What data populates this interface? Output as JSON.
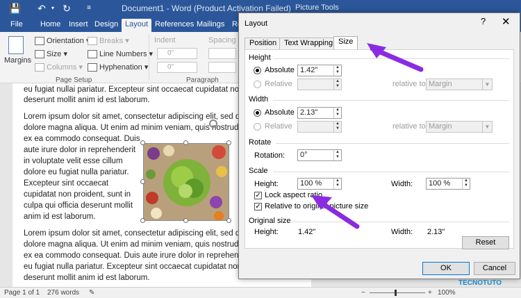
{
  "app": {
    "title": "Document1 - Word (Product Activation Failed)",
    "context_tab": "Picture Tools",
    "file_tab": "File",
    "tabs": [
      "Home",
      "Insert",
      "Design",
      "Layout",
      "References",
      "Mailings",
      "Re"
    ],
    "active_tab": "Layout"
  },
  "ribbon": {
    "margins": "Margins",
    "orientation": "Orientation",
    "size": "Size",
    "columns": "Columns",
    "breaks": "Breaks",
    "line_numbers": "Line Numbers",
    "hyphenation": "Hyphenation",
    "group_page_setup": "Page Setup",
    "indent": "Indent",
    "spacing": "Spacing",
    "indent_left": "0\"",
    "indent_right": "0\"",
    "spacing_before": "",
    "spacing_after": "",
    "group_paragraph": "Paragraph"
  },
  "document": {
    "p1a": "eu fugiat nullai pariatur. Excepteur sint occaecat cupidatat non",
    "p1b": "deserunt mollit anim id est laborum.",
    "p2a": "Lorem ipsum dolor sit amet, consectetur adipiscing elit, sed do",
    "p2b": "dolore magna aliqua. Ut enim ad minim veniam, quis nostrud e",
    "p2c": "ex ea commodo consequat. Duis",
    "p2d": "aute irure dolor in reprehenderit",
    "p2e": "in voluptate velit esse cillum",
    "p2f": "dolore eu fugiat nulla pariatur.",
    "p2g": "Excepteur sint occaecat",
    "p2h": "cupidatat non proident, sunt in",
    "p2i": "culpa qui officia deserunt mollit",
    "p2j": "anim id est laborum.",
    "p3a": "Lorem ipsum dolor sit amet, consectetur adipiscing elit, sed do",
    "p3b": "dolore magna aliqua. Ut enim ad minim veniam, quis nostrud e",
    "p3c": "ex ea commodo consequat. Duis aute irure dolor in reprehende",
    "p3d": "eu fugiat nulla pariatur. Excepteur sint occaecat cupidatat non",
    "p3e": "deserunt mollit anim id est laborum."
  },
  "status": {
    "page": "Page 1 of 1",
    "words": "276 words",
    "zoom": "100%"
  },
  "dialog": {
    "title": "Layout",
    "help": "?",
    "close": "✕",
    "tabs": [
      "Position",
      "Text Wrapping",
      "Size"
    ],
    "active_tab": "Size",
    "height": {
      "section": "Height",
      "absolute_label": "Absolute",
      "absolute_value": "1.42\"",
      "relative_label": "Relative",
      "relative_value": "",
      "relative_to_label": "relative to",
      "relative_to_value": "Margin"
    },
    "width": {
      "section": "Width",
      "absolute_label": "Absolute",
      "absolute_value": "2.13\"",
      "relative_label": "Relative",
      "relative_value": "",
      "relative_to_label": "relative to",
      "relative_to_value": "Margin"
    },
    "rotate": {
      "section": "Rotate",
      "rotation_label": "Rotation:",
      "rotation_value": "0°"
    },
    "scale": {
      "section": "Scale",
      "height_label": "Height:",
      "height_value": "100 %",
      "width_label": "Width:",
      "width_value": "100 %",
      "lock_aspect_label": "Lock aspect ratio",
      "lock_aspect_checked": true,
      "relative_original_label": "Relative to original picture size",
      "relative_original_checked": true
    },
    "original": {
      "section": "Original size",
      "height_label": "Height:",
      "height_value": "1.42\"",
      "width_label": "Width:",
      "width_value": "2.13\""
    },
    "reset": "Reset",
    "ok": "OK",
    "cancel": "Cancel"
  },
  "watermark": "TECNOTUTO",
  "colors": {
    "word_blue": "#2b579a",
    "arrow_purple": "#8a2be2"
  }
}
